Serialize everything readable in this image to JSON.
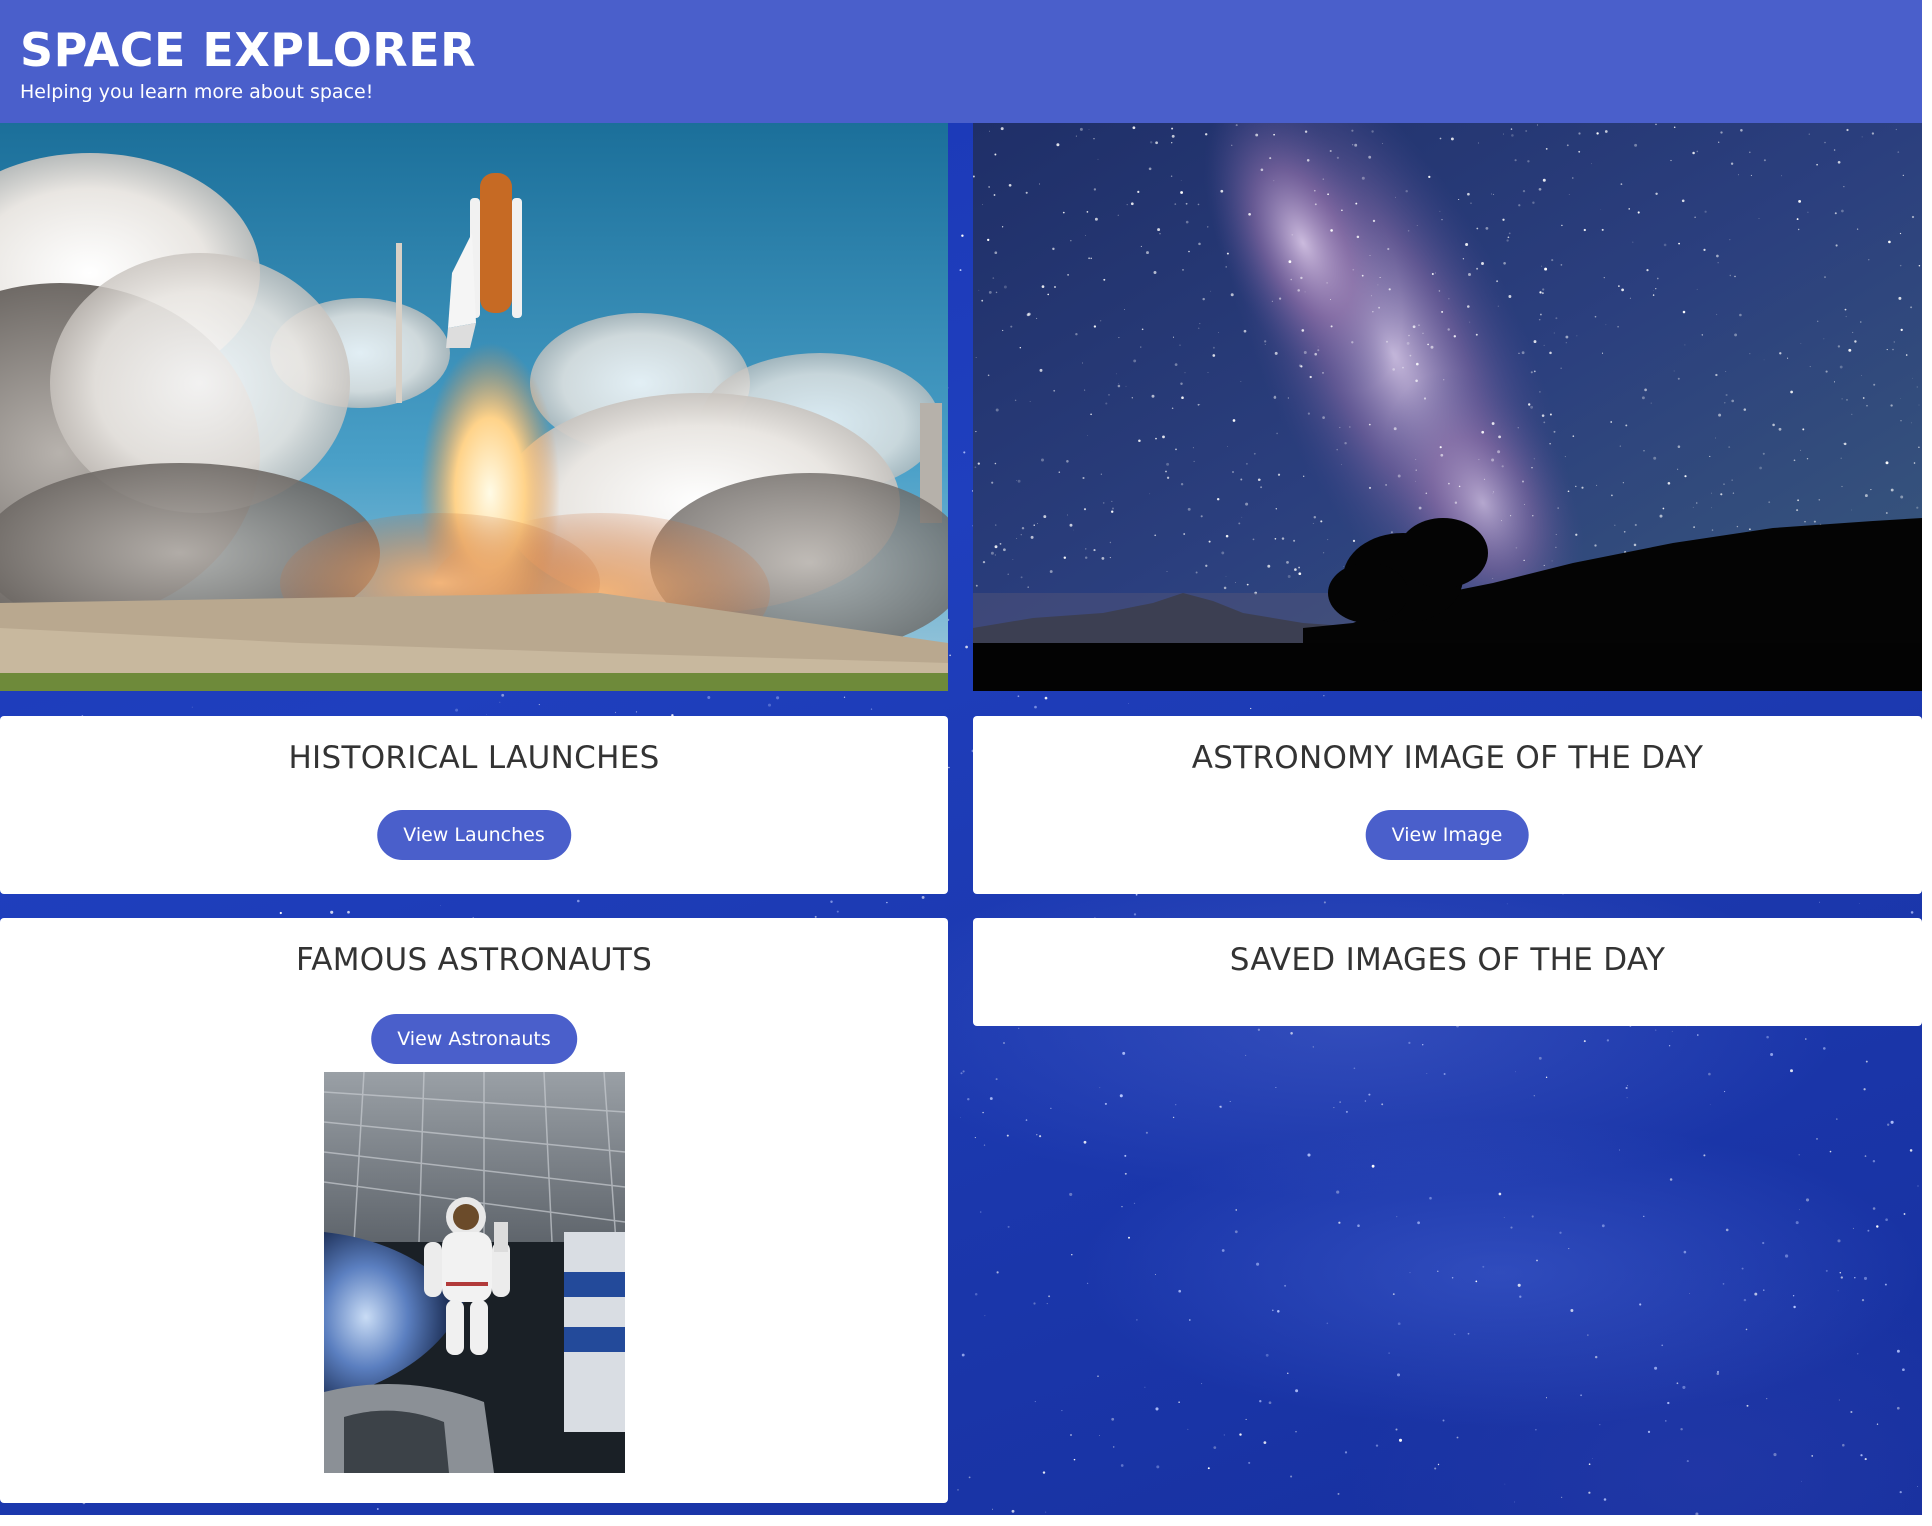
{
  "header": {
    "title": "SPACE EXPLORER",
    "subtitle": "Helping you learn more about space!",
    "background_color": "#4a5fcb"
  },
  "hero": {
    "left_image": "shuttle-launch-image",
    "right_image": "milky-way-image"
  },
  "cards": {
    "launches": {
      "title": "HISTORICAL LAUNCHES",
      "button_label": "View Launches"
    },
    "apod": {
      "title": "ASTRONOMY IMAGE OF THE DAY",
      "button_label": "View Image"
    },
    "astronauts": {
      "title": "FAMOUS ASTRONAUTS",
      "button_label": "View Astronauts",
      "image": "astronaut-image"
    },
    "saved": {
      "title": "SAVED IMAGES OF THE DAY"
    }
  },
  "colors": {
    "accent": "#4a5fcb",
    "card_text": "#333333",
    "space_blue": "#1f3fbe"
  }
}
